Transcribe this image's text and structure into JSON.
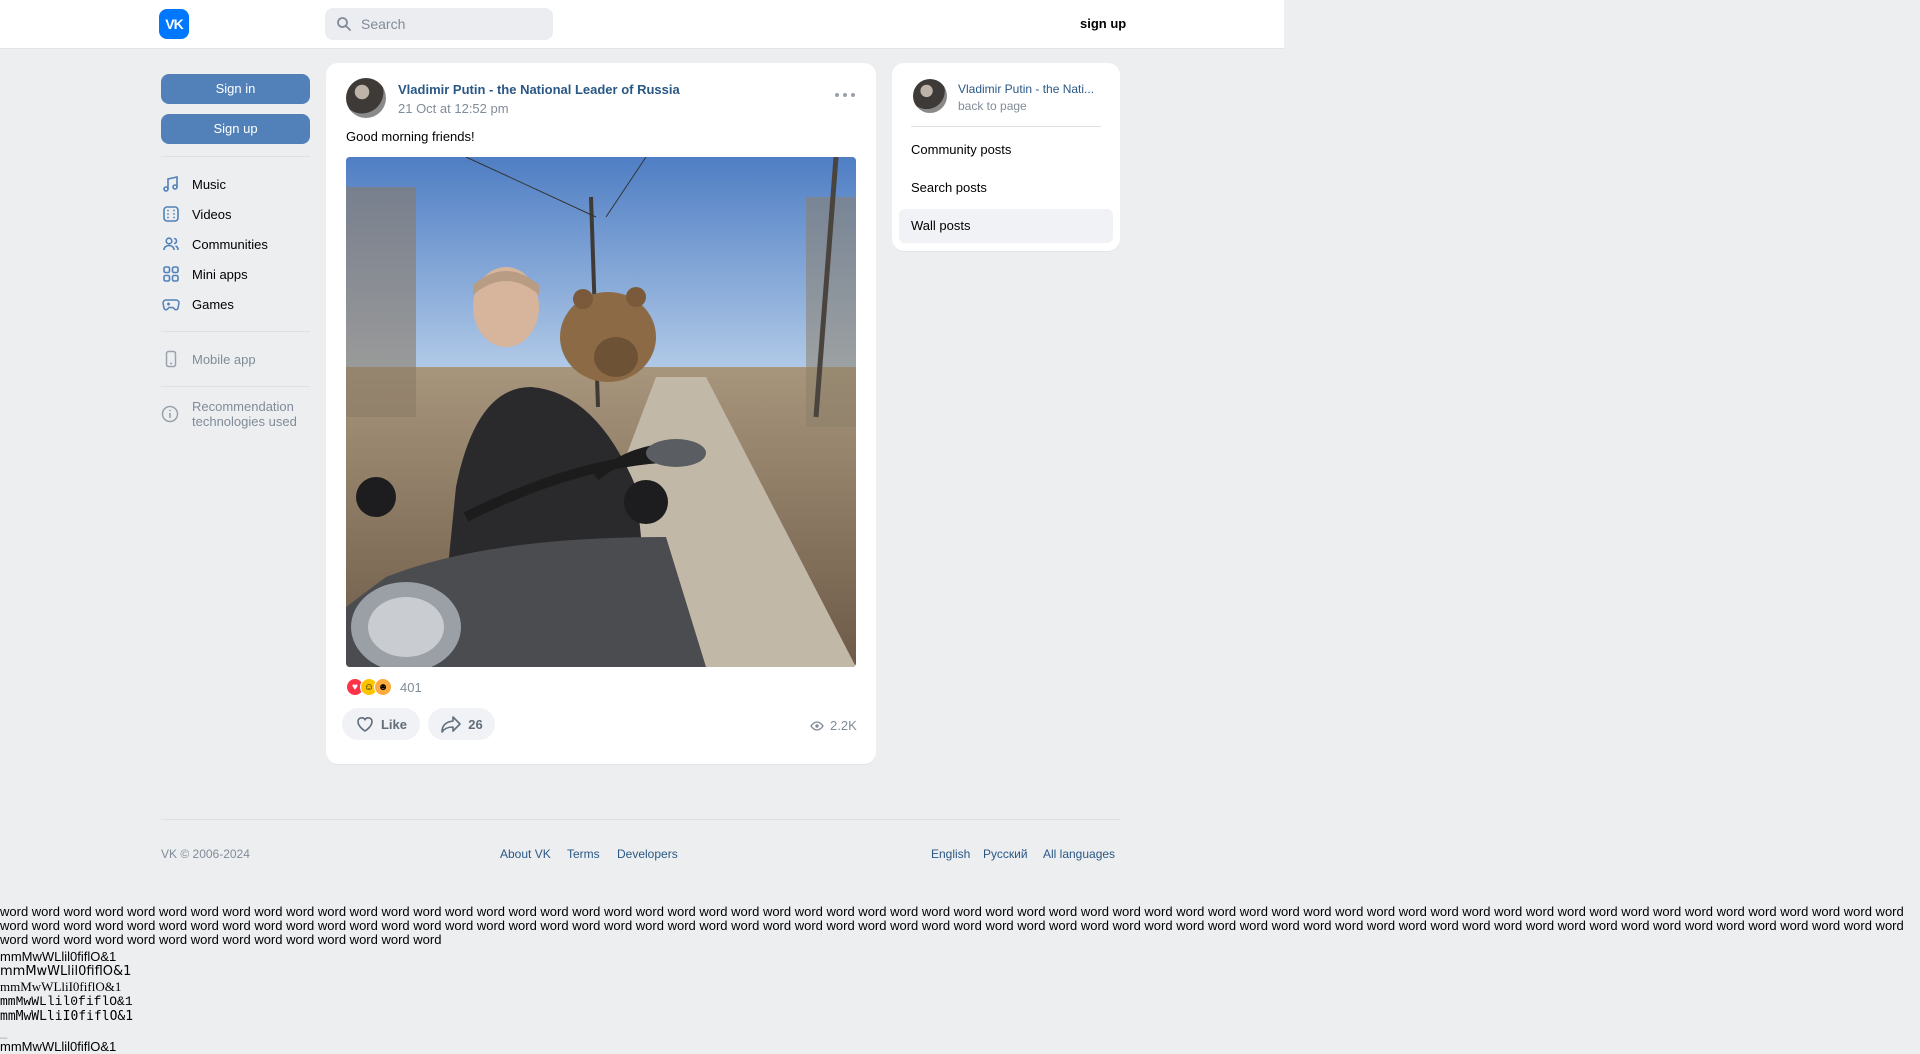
{
  "header": {
    "logo_text": "VK",
    "search_placeholder": "Search",
    "signup_label": "sign up"
  },
  "leftnav": {
    "sign_in": "Sign in",
    "sign_up": "Sign up",
    "items": [
      {
        "label": "Music",
        "icon": "music-icon"
      },
      {
        "label": "Videos",
        "icon": "video-icon"
      },
      {
        "label": "Communities",
        "icon": "users-icon"
      },
      {
        "label": "Mini apps",
        "icon": "apps-icon"
      },
      {
        "label": "Games",
        "icon": "gamepad-icon"
      }
    ],
    "mobile_app": "Mobile app",
    "rec_line1": "Recommendation",
    "rec_line2": "technologies used"
  },
  "post": {
    "author": "Vladimir Putin - the National Leader of Russia",
    "date": "21 Oct at 12:52 pm",
    "text": "Good morning friends!",
    "reactions_count": "401",
    "like_label": "Like",
    "share_count": "26",
    "views": "2.2K"
  },
  "widget": {
    "name": "Vladimir Putin - the Nati...",
    "back": "back to page",
    "items": [
      "Community posts",
      "Search posts",
      "Wall posts"
    ],
    "active_item": "Wall posts"
  },
  "footer": {
    "copyright": "VK © 2006-2024",
    "about": "About VK",
    "terms": "Terms",
    "developers": "Developers",
    "english": "English",
    "russian": "Русский",
    "all_languages": "All languages"
  },
  "test_text": {
    "words": "word word word word word word word word word word word word word word word word word word word word word word word word word word word word word word word word word word word word word word word word word word word word word word word word word word word word word word word word word word word word word word word word word word word word word word word word word word word word word word word word word word word word word word word word word word word word word word word word word word word word word word word word word word word word word word word word word word word word word word word word word word word word word word word word word word word word word word",
    "glyph_line_1": "mmMwWLlil0fiflO&1",
    "glyph_line_2": "mmMwWLlil0fiflO&1",
    "glyph_line_3": "mmMwWLliI0fiflO&1",
    "glyph_line_4": "mmMwWLlil0fiflO&1",
    "glyph_line_5": "mmMwWLliI0fiflO&1",
    "glyph_line_6": "mmMwWLlil0fiflO&1"
  },
  "colors": {
    "accent": "#0077ff",
    "button": "#5181b8",
    "link": "#2a5885",
    "background": "#edeef0"
  }
}
